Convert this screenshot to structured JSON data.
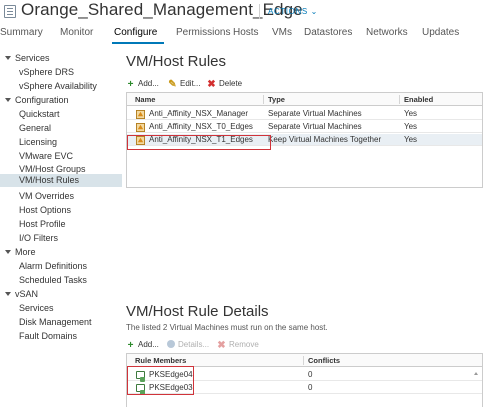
{
  "header": {
    "title": "Orange_Shared_Management_Edge",
    "actions_label": "ACTIONS ⌄"
  },
  "tabs": [
    {
      "label": "Summary",
      "active": false
    },
    {
      "label": "Monitor",
      "active": false
    },
    {
      "label": "Configure",
      "active": true
    },
    {
      "label": "Permissions",
      "active": false
    },
    {
      "label": "Hosts",
      "active": false
    },
    {
      "label": "VMs",
      "active": false
    },
    {
      "label": "Datastores",
      "active": false
    },
    {
      "label": "Networks",
      "active": false
    },
    {
      "label": "Updates",
      "active": false
    }
  ],
  "sidebar": {
    "groups": [
      {
        "label": "Services",
        "items": [
          "vSphere DRS",
          "vSphere Availability"
        ]
      },
      {
        "label": "Configuration",
        "items": [
          "Quickstart",
          "General",
          "Licensing",
          "VMware EVC",
          "VM/Host Groups",
          "VM/Host Rules",
          "VM Overrides",
          "Host Options",
          "Host Profile",
          "I/O Filters"
        ]
      },
      {
        "label": "More",
        "items": [
          "Alarm Definitions",
          "Scheduled Tasks"
        ]
      },
      {
        "label": "vSAN",
        "items": [
          "Services",
          "Disk Management",
          "Fault Domains"
        ]
      }
    ],
    "selected": "VM/Host Rules"
  },
  "rules": {
    "heading": "VM/Host Rules",
    "toolbar": {
      "add": "Add...",
      "edit": "Edit...",
      "delete": "Delete"
    },
    "columns": [
      "Name",
      "Type",
      "Enabled"
    ],
    "rows": [
      {
        "name": "Anti_Affinity_NSX_Manager",
        "type": "Separate Virtual Machines",
        "enabled": "Yes"
      },
      {
        "name": "Anti_Affinity_NSX_T0_Edges",
        "type": "Separate Virtual Machines",
        "enabled": "Yes"
      },
      {
        "name": "Anti_Affinity_NSX_T1_Edges",
        "type": "Keep Virtual Machines Together",
        "enabled": "Yes"
      }
    ]
  },
  "details": {
    "heading": "VM/Host Rule Details",
    "description": "The listed 2 Virtual Machines must run on the same host.",
    "toolbar": {
      "add": "Add...",
      "details": "Details...",
      "remove": "Remove"
    },
    "columns": [
      "Rule Members",
      "Conflicts"
    ],
    "rows": [
      {
        "member": "PKSEdge04",
        "conflicts": "0"
      },
      {
        "member": "PKSEdge03",
        "conflicts": "0"
      }
    ]
  },
  "colors": {
    "accent": "#0079b8",
    "highlight": "#d0333a",
    "selected_bg": "#d8e3e9"
  }
}
